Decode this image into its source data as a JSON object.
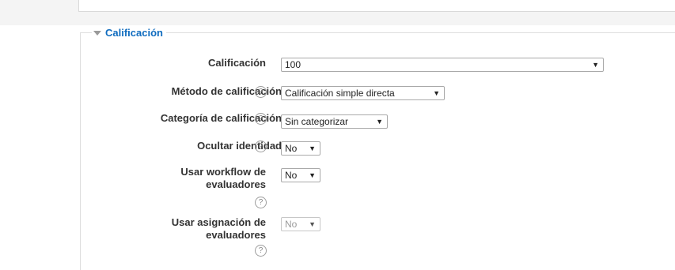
{
  "section": {
    "title": "Calificación"
  },
  "fields": {
    "grade": {
      "label": "Calificación",
      "value": "100"
    },
    "grading_method": {
      "label": "Método de calificación",
      "value": "Calificación simple directa"
    },
    "grade_category": {
      "label": "Categoría de calificación",
      "value": "Sin categorizar"
    },
    "blind_marking": {
      "label": "Ocultar identidad",
      "value": "No"
    },
    "marking_workflow": {
      "label": "Usar workflow de evaluadores",
      "value": "No"
    },
    "marking_allocation": {
      "label": "Usar asignación de evaluadores",
      "value": "No",
      "disabled": true
    }
  },
  "icons": {
    "help": "?",
    "dropdown": "▼",
    "collapse": "triangle-down"
  },
  "colors": {
    "legend": "#0f6cbf",
    "label": "#333333",
    "help_icon": "#9d9d9d"
  }
}
